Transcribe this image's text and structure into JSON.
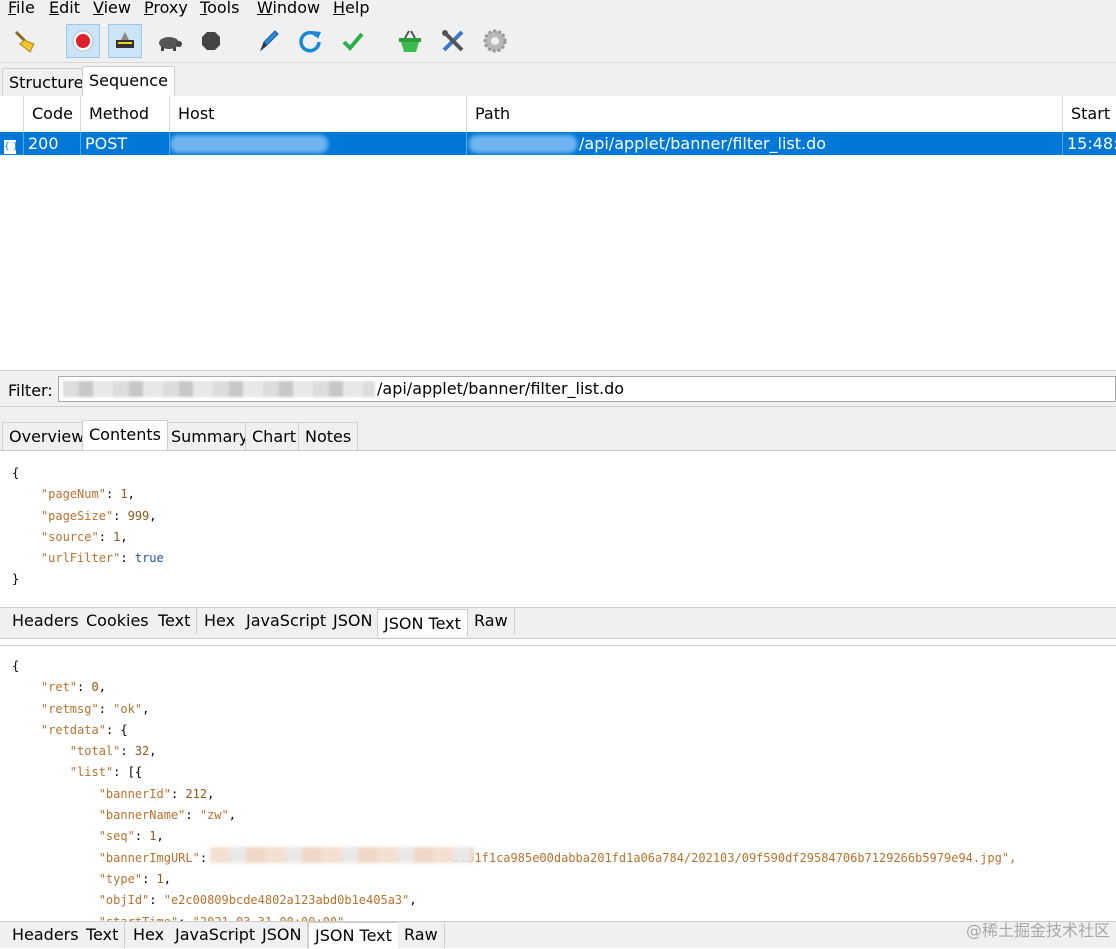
{
  "menu": [
    "File",
    "Edit",
    "View",
    "Proxy",
    "Tools",
    "Window",
    "Help"
  ],
  "toolbar_icons": [
    "broom-icon",
    "record-icon",
    "intercept-icon",
    "throttle-turtle-icon",
    "stop-icon",
    "compose-pen-icon",
    "repeat-icon",
    "validate-check-icon",
    "basket-icon",
    "tools-icon",
    "settings-gear-icon"
  ],
  "view_tabs": [
    "Structure",
    "Sequence"
  ],
  "columns": [
    "Code",
    "Method",
    "Host",
    "Path",
    "Start"
  ],
  "row": {
    "icon": "{ }",
    "code": "200",
    "method": "POST",
    "path": "/api/applet/banner/filter_list.do",
    "start": "15:48:"
  },
  "filter": {
    "label": "Filter:",
    "value": "/api/applet/banner/filter_list.do"
  },
  "detail_tabs": [
    "Overview",
    "Contents",
    "Summary",
    "Chart",
    "Notes"
  ],
  "request_json": [
    "{",
    "    \"pageNum\": 1,",
    "    \"pageSize\": 999,",
    "    \"source\": 1,",
    "    \"urlFilter\": true",
    "}"
  ],
  "format_tabs": [
    "Headers",
    "Cookies",
    "Text",
    "Hex",
    "JavaScript",
    "JSON",
    "JSON Text",
    "Raw"
  ],
  "response_json": [
    "{",
    "    \"ret\": 0,",
    "    \"retmsg\": \"ok\",",
    "    \"retdata\": {",
    "        \"total\": 32,",
    "        \"list\": [{",
    "            \"bannerId\": 212,",
    "            \"bannerName\": \"zw\",",
    "            \"seq\": 1,",
    "            \"bannerImgURL\":",
    "            \"type\": 1,",
    "            \"objId\": \"e2c00809bcde4802a123abd0b1e405a3\",",
    "            \"startTime\": \"2021-03-31 00:00:00\""
  ],
  "banner_img_tail": "3e51f1ca985e00dabba201fd1a06a784/202103/09f590df29584706b7129266b5979e94.jpg\",",
  "bottom_tabs": [
    "Headers",
    "Text",
    "Hex",
    "JavaScript",
    "JSON",
    "JSON Text",
    "Raw"
  ],
  "watermark": "@稀土掘金技术社区"
}
